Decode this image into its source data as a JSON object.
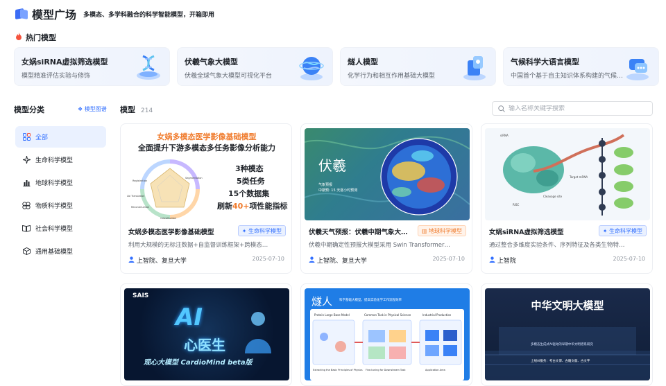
{
  "header": {
    "title": "模型广场",
    "subtitle": "多模态、多学科融合的科学智能模型，开箱即用"
  },
  "hot": {
    "heading": "热门模型",
    "cards": [
      {
        "title": "女娲siRNA虚拟筛选模型",
        "desc": "模型精准评估实验与修饰",
        "icon": "dna-icon"
      },
      {
        "title": "伏羲气象大模型",
        "desc": "伏羲全球气象大模型可视化平台",
        "icon": "globe-icon"
      },
      {
        "title": "燧人模型",
        "desc": "化学行为和相互作用基础大模型",
        "icon": "molecule-icon"
      },
      {
        "title": "气候科学大语言模型",
        "desc": "中国首个基于自主知识体系构建的气候科学大语言模型",
        "icon": "chat-bubble-icon"
      }
    ]
  },
  "sidebar": {
    "heading": "模型分类",
    "link": "模型图谱",
    "items": [
      {
        "label": "全部",
        "icon": "grid-icon",
        "active": true
      },
      {
        "label": "生命科学模型",
        "icon": "sparkle-icon"
      },
      {
        "label": "地球科学模型",
        "icon": "chart-bars-icon"
      },
      {
        "label": "物质科学模型",
        "icon": "atom-icon"
      },
      {
        "label": "社会科学模型",
        "icon": "book-icon"
      },
      {
        "label": "通用基础模型",
        "icon": "cube-icon"
      }
    ]
  },
  "main": {
    "heading": "模型",
    "count": "214",
    "search_placeholder": "输入名称关键字搜索"
  },
  "cards": [
    {
      "title": "女娲多模态医学影像基础模型",
      "tag": "生命科学模型",
      "tag_type": "life",
      "desc": "利用大规模的无标注数据+自监督训练框架+跨模态…",
      "org": "上智院、复旦大学",
      "date": "2025-07-10",
      "thumb": {
        "heading1": "女娲多模态医学影像基础模型",
        "heading2": "全面提升下游多模态多任务影像分析能力",
        "line1": "3种模态",
        "line2": "5类任务",
        "line3": "15个数据集",
        "line4a": "刷新",
        "line4b": "40+",
        "line4c": "项性能指标",
        "radar_labels": [
          "Segmentation",
          "Classification",
          "Reconstruction",
          "Lbl Translation",
          "Registration"
        ]
      }
    },
    {
      "title": "伏羲天气预报：伏羲中期气象大…",
      "tag": "地球科学模型",
      "tag_type": "earth",
      "desc": "伏羲中期确定性预报大模型采用 Swin Transformer…",
      "org": "上智院、复旦大学",
      "date": "2025-07-10",
      "thumb": {
        "name": "伏羲",
        "caption1": "气象预报",
        "caption2": "中期预: 15 天逐小时预测"
      }
    },
    {
      "title": "女娲siRNA虚拟筛选模型",
      "tag": "生命科学模型",
      "tag_type": "life",
      "desc": "通过整合多维度实验条件、序列特征及各类生物特…",
      "org": "上智院",
      "date": "2025-07-10",
      "thumb": {
        "label1": "siRNA",
        "label2": "Target mRNA",
        "label3": "RISC",
        "label4": "Cleavage site"
      }
    },
    {
      "title": "",
      "thumb": {
        "brand": "SAIS",
        "line1": "AI",
        "line2": "心医生",
        "line3": "观心大模型 CardioMind beta版"
      }
    },
    {
      "title": "",
      "thumb": {
        "name": "燧人",
        "desc": "科学基础大模型，提高实验化学工作流程效率",
        "p1": "Protein Large Base Model",
        "p2": "Common Task in Physical Science",
        "p3": "Industrial Production",
        "f1": "Extracting the Basic Principles of Physics",
        "f2": "Fine-tuning for Downstream Task",
        "f3": "Application Area"
      }
    },
    {
      "title": "",
      "thumb": {
        "name": "中华文明大模型",
        "line1": "多模态生成式AI驱动的早期中华文明谱系研究",
        "line2": "上线AI服务：考古文博、古籍文献、古文字"
      }
    }
  ],
  "colors": {
    "accent": "#3370ff",
    "text": "#1f2329",
    "muted": "#646a73"
  }
}
